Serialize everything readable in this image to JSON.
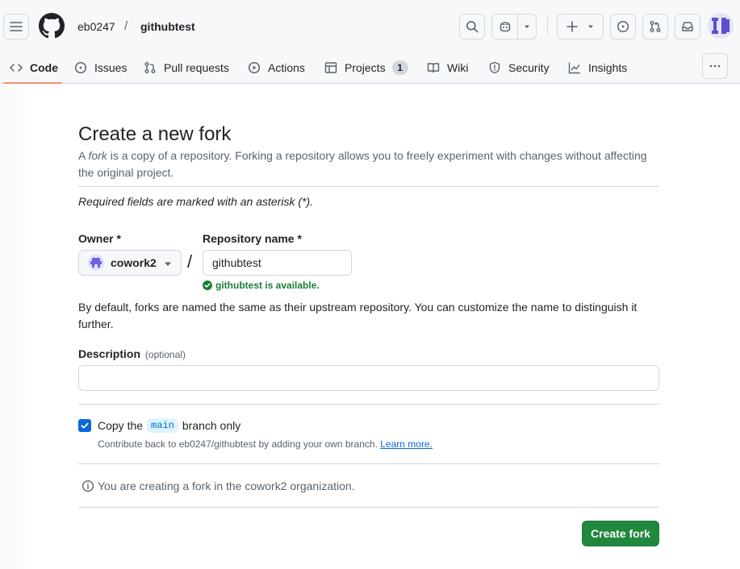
{
  "header": {
    "owner": "eb0247",
    "separator": "/",
    "repo": "githubtest"
  },
  "tabs": [
    {
      "label": "Code",
      "icon": "code-icon",
      "selected": true
    },
    {
      "label": "Issues",
      "icon": "issue-opened-icon"
    },
    {
      "label": "Pull requests",
      "icon": "git-pull-request-icon"
    },
    {
      "label": "Actions",
      "icon": "play-icon"
    },
    {
      "label": "Projects",
      "icon": "table-icon",
      "counter": "1"
    },
    {
      "label": "Wiki",
      "icon": "book-icon"
    },
    {
      "label": "Security",
      "icon": "shield-icon"
    },
    {
      "label": "Insights",
      "icon": "graph-icon"
    }
  ],
  "form": {
    "title": "Create a new fork",
    "subtitle_before": "A ",
    "subtitle_em": "fork",
    "subtitle_after": " is a copy of a repository. Forking a repository allows you to freely experiment with changes without affecting the original project.",
    "required_note": "Required fields are marked with an asterisk (*).",
    "owner_label": "Owner *",
    "owner_value": "cowork2",
    "repo_label": "Repository name *",
    "repo_value": "githubtest",
    "slash": "/",
    "availability": "githubtest is available.",
    "default_note": "By default, forks are named the same as their upstream repository. You can customize the name to distinguish it further.",
    "description_label": "Description",
    "description_optional": "(optional)",
    "description_value": "",
    "copy_checked": true,
    "copy_before": "Copy the",
    "copy_branch": "main",
    "copy_after": "branch only",
    "copy_hint": "Contribute back to eb0247/githubtest by adding your own branch.",
    "learn_more": "Learn more.",
    "org_info": "You are creating a fork in the cowork2 organization.",
    "submit_label": "Create fork"
  },
  "colors": {
    "accent": "#0969da",
    "success": "#1a7f37",
    "primary_button": "#1f883d",
    "tab_underline": "#fd8c73",
    "border": "#d1d9e0"
  }
}
